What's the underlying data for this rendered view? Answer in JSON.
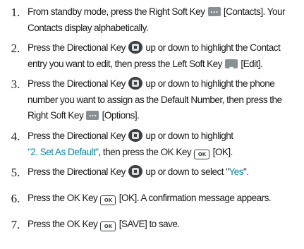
{
  "icons": {
    "soft_key": "soft-key-icon",
    "directional_key": "directional-key-icon",
    "ok_key": "ok-key-icon"
  },
  "colors": {
    "highlight": "#0a86a3",
    "text": "#1a1a1a",
    "soft_key_gray": "#8a8f94"
  },
  "ok_key_label": "OK",
  "steps": [
    {
      "number": "1.",
      "line1_pre": "From standby mode, press the Right Soft Key",
      "line1_post": "[Contacts]. Your",
      "line2": "Contacts display alphabetically."
    },
    {
      "number": "2.",
      "line1_pre": "Press the Directional Key",
      "line1_post": "up or down to highlight the Contact",
      "line2_pre": "entry you want to edit, then press the Left Soft Key",
      "line2_post": "[Edit]."
    },
    {
      "number": "3.",
      "line1_pre": "Press the Directional Key",
      "line1_post": "up or down to highlight the phone",
      "line2": "number you want to assign as the Default Number, then press the",
      "line3_pre": "Right Soft Key",
      "line3_post": "[Options]."
    },
    {
      "number": "4.",
      "line1_pre": "Press the Directional Key",
      "line1_post": "up or down to highlight",
      "line2_highlight": "\"2. Set As Default\"",
      "line2_mid": ", then press the OK Key",
      "line2_post": "[OK]."
    },
    {
      "number": "5.",
      "line1_pre": "Press the Directional Key",
      "line1_mid": "up or down to select \"",
      "line1_highlight": "Yes",
      "line1_post": "\"."
    },
    {
      "number": "6.",
      "line1_pre": "Press the OK Key",
      "line1_post": "[OK]. A confirmation message appears."
    },
    {
      "number": "7.",
      "line1_pre": "Press the OK Key",
      "line1_post": "[SAVE] to save."
    }
  ]
}
